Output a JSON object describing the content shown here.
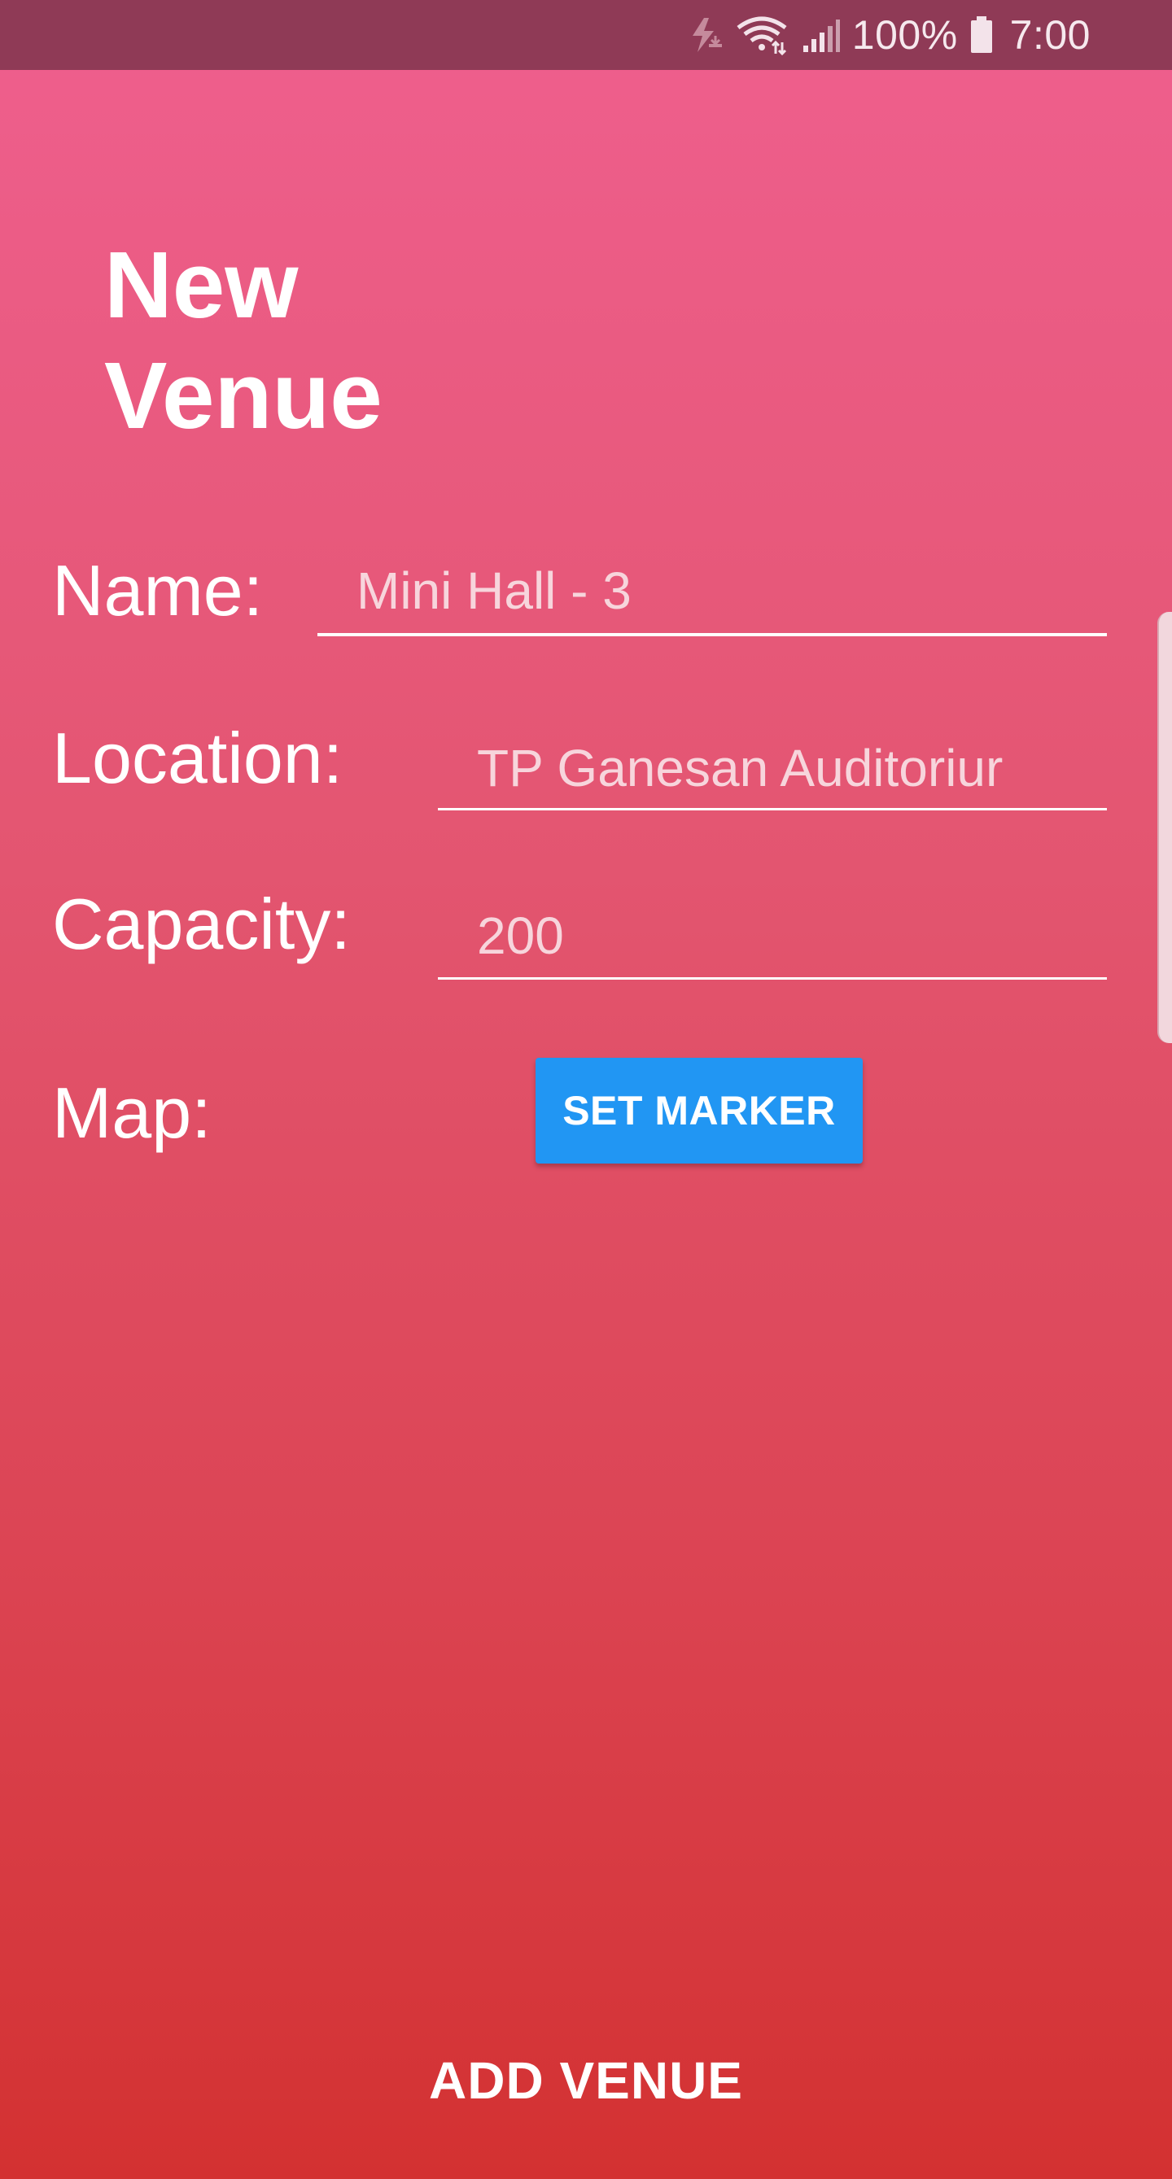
{
  "status_bar": {
    "battery_text": "100%",
    "time": "7:00",
    "icons": [
      "charging-sync-icon",
      "wifi-icon",
      "signal-icon",
      "battery-icon"
    ]
  },
  "page": {
    "title": "New Venue"
  },
  "form": {
    "name_label": "Name:",
    "name_value": "Mini Hall - 3",
    "location_label": "Location:",
    "location_value": "TP Ganesan Auditoriur",
    "capacity_label": "Capacity:",
    "capacity_value": "200",
    "map_label": "Map:",
    "set_marker_label": "SET MARKER"
  },
  "footer": {
    "add_venue_label": "ADD VENUE"
  },
  "colors": {
    "status_bar": "#8f3a56",
    "gradient_top": "#ef5f8e",
    "gradient_bottom": "#d33131",
    "button_blue": "#2196f3"
  }
}
